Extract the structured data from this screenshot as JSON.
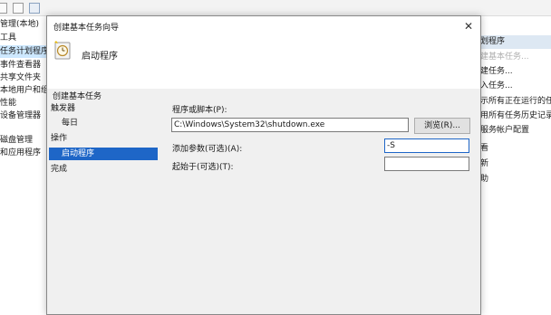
{
  "background": {
    "left_items": [
      "管理(本地)",
      "工具",
      "任务计划程序",
      "事件查看器",
      "共享文件夹",
      "本地用户和组",
      "性能",
      "设备管理器",
      "磁盘管理",
      "和应用程序"
    ],
    "right_items": [
      "划程序",
      "建基本任务...",
      "建任务...",
      "入任务...",
      "示所有正在运行的任",
      "用所有任务历史记录",
      "服务帐户配置",
      "看",
      "新",
      "助"
    ]
  },
  "dialog": {
    "title": "创建基本任务向导",
    "close": "✕",
    "header_title": "启动程序",
    "nav_title": "创建基本任务",
    "nav": [
      "触发器",
      "每日",
      "操作",
      "启动程序",
      "完成"
    ],
    "program_label": "程序或脚本(P):",
    "program_value": "C:\\Windows\\System32\\shutdown.exe",
    "browse_label": "浏览(R)...",
    "args_label": "添加参数(可选)(A):",
    "args_value": "-S",
    "start_in_label": "起始于(可选)(T):",
    "start_in_value": ""
  }
}
